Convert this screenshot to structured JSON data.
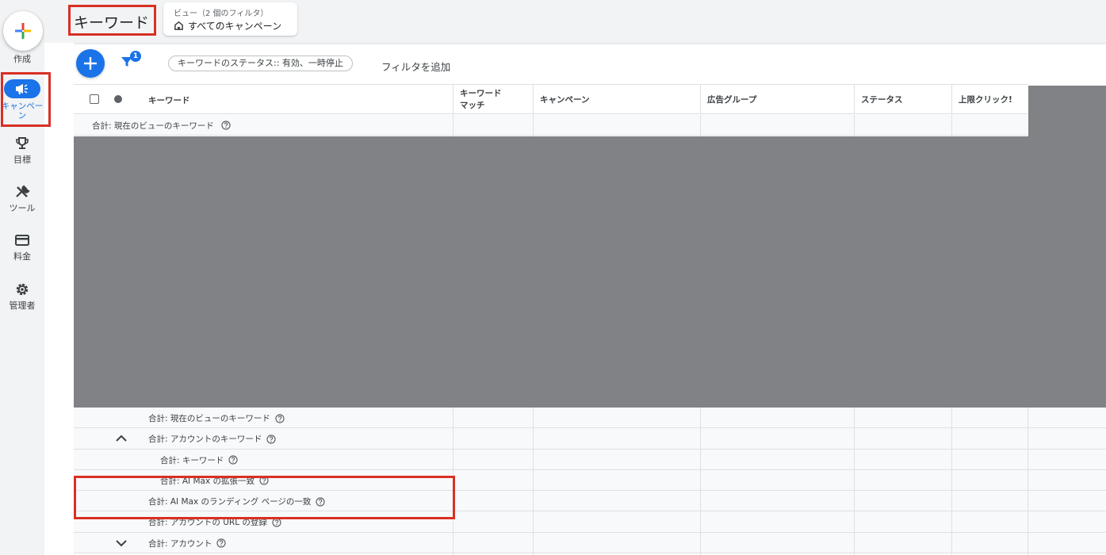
{
  "rail": {
    "create_label": "作成",
    "items": [
      {
        "label": "キャンペーン",
        "icon": "megaphone-icon",
        "active": true
      },
      {
        "label": "目標",
        "icon": "trophy-icon"
      },
      {
        "label": "ツール",
        "icon": "tools-icon"
      },
      {
        "label": "料金",
        "icon": "credit-card-icon"
      },
      {
        "label": "管理者",
        "icon": "gear-icon"
      }
    ]
  },
  "header": {
    "title": "キーワード",
    "view_sub": "ビュー（2 個のフィルタ）",
    "view_main": "すべてのキャンペーン"
  },
  "toolbar": {
    "filter_badge": "1",
    "filter_chip": "キーワードのステータス:: 有効、一時停止",
    "add_filter": "フィルタを追加"
  },
  "table": {
    "columns": [
      "キーワード",
      "キーワード\nマッチ",
      "キャンペーン",
      "広告グループ",
      "ステータス",
      "上限クリック!"
    ],
    "summary_top": "合計: 現在のビューのキーワード",
    "rows": [
      {
        "label": "合計: 現在のビューのキーワード",
        "indent": 94,
        "chevron": ""
      },
      {
        "label": "合計: アカウントのキーワード",
        "indent": 94,
        "chevron": "up"
      },
      {
        "label": "合計: キーワード",
        "indent": 109,
        "chevron": ""
      },
      {
        "label": "合計: AI Max の拡張一致",
        "indent": 109,
        "chevron": ""
      },
      {
        "label": "合計: AI Max のランディング ページの一致",
        "indent": 94,
        "chevron": ""
      },
      {
        "label": "合計: アカウントの URL の登録",
        "indent": 94,
        "chevron": ""
      },
      {
        "label": "合計: アカウント",
        "indent": 94,
        "chevron": "down"
      }
    ]
  },
  "colors": {
    "accent": "#1a73e8",
    "highlight": "#d93025",
    "redaction": "#808285"
  }
}
